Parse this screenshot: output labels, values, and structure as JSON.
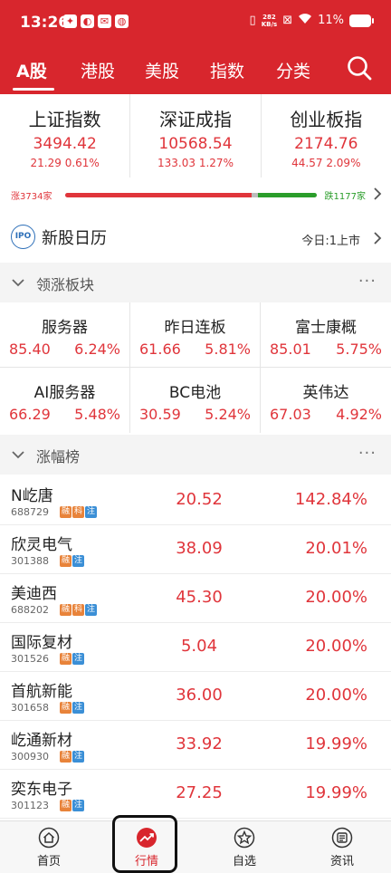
{
  "status": {
    "time": "13:26",
    "netspeed_value": "282",
    "netspeed_unit": "KB/s",
    "battery": "11%"
  },
  "tabs": [
    {
      "label": "A股",
      "active": true
    },
    {
      "label": "港股",
      "active": false
    },
    {
      "label": "美股",
      "active": false
    },
    {
      "label": "指数",
      "active": false
    },
    {
      "label": "分类",
      "active": false
    }
  ],
  "indices": [
    {
      "name": "上证指数",
      "value": "3494.42",
      "change": "21.29",
      "pct": "0.61%"
    },
    {
      "name": "深证成指",
      "value": "10568.54",
      "change": "133.03",
      "pct": "1.27%"
    },
    {
      "name": "创业板指",
      "value": "2174.76",
      "change": "44.57",
      "pct": "2.09%"
    }
  ],
  "breadth": {
    "up_label": "涨3734家",
    "down_label": "跌1177家",
    "up_count": 3734,
    "flat_count": 120,
    "down_count": 1177
  },
  "newstock": {
    "icon_text": "IPO",
    "title": "新股日历",
    "today": "今日:1上市"
  },
  "sectors_section": {
    "title": "领涨板块",
    "more": "···"
  },
  "sectors": [
    {
      "name": "服务器",
      "value": "85.40",
      "pct": "6.24%"
    },
    {
      "name": "昨日连板",
      "value": "61.66",
      "pct": "5.81%"
    },
    {
      "name": "富士康概",
      "value": "85.01",
      "pct": "5.75%"
    },
    {
      "name": "AI服务器",
      "value": "66.29",
      "pct": "5.48%"
    },
    {
      "name": "BC电池",
      "value": "30.59",
      "pct": "5.24%"
    },
    {
      "name": "英伟达",
      "value": "67.03",
      "pct": "4.92%"
    }
  ],
  "gainers_section": {
    "title": "涨幅榜",
    "more": "···"
  },
  "gainers": [
    {
      "name": "N屹唐",
      "code": "688729",
      "tags": [
        "融",
        "科",
        "注"
      ],
      "price": "20.52",
      "pct": "142.84%"
    },
    {
      "name": "欣灵电气",
      "code": "301388",
      "tags": [
        "融",
        "注"
      ],
      "price": "38.09",
      "pct": "20.01%"
    },
    {
      "name": "美迪西",
      "code": "688202",
      "tags": [
        "融",
        "科",
        "注"
      ],
      "price": "45.30",
      "pct": "20.00%"
    },
    {
      "name": "国际复材",
      "code": "301526",
      "tags": [
        "融",
        "注"
      ],
      "price": "5.04",
      "pct": "20.00%"
    },
    {
      "name": "首航新能",
      "code": "301658",
      "tags": [
        "融",
        "注"
      ],
      "price": "36.00",
      "pct": "20.00%"
    },
    {
      "name": "屹通新材",
      "code": "300930",
      "tags": [
        "融",
        "注"
      ],
      "price": "33.92",
      "pct": "19.99%"
    },
    {
      "name": "奕东电子",
      "code": "301123",
      "tags": [
        "融",
        "注"
      ],
      "price": "27.25",
      "pct": "19.99%"
    }
  ],
  "bottom_nav": [
    {
      "label": "首页",
      "icon": "home-icon",
      "active": false
    },
    {
      "label": "行情",
      "icon": "market-trend-icon",
      "active": true
    },
    {
      "label": "自选",
      "icon": "star-icon",
      "active": false
    },
    {
      "label": "资讯",
      "icon": "news-icon",
      "active": false
    }
  ],
  "colors": {
    "brand_red": "#d8262d",
    "up_red": "#e0353b",
    "down_green": "#2a9d2a"
  }
}
